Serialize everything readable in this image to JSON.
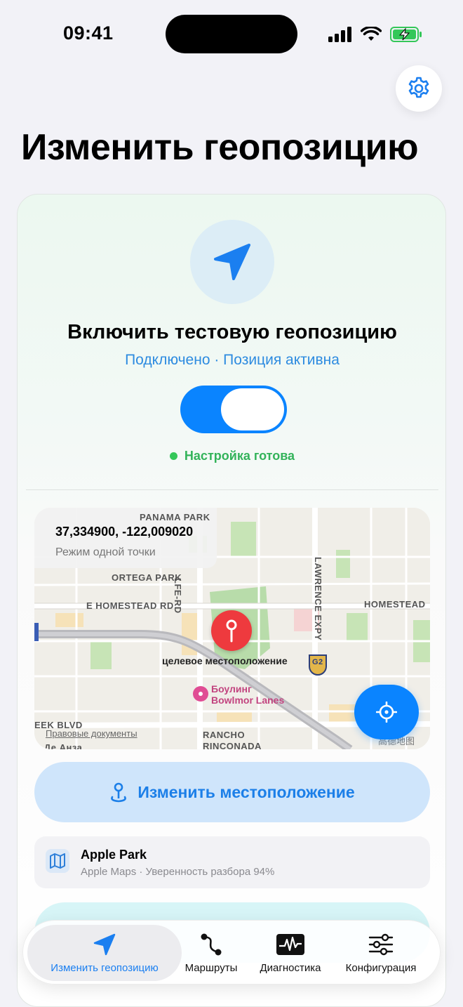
{
  "status_bar": {
    "time": "09:41"
  },
  "page_title": "Изменить геопозицию",
  "hero": {
    "title": "Включить тестовую геопозицию",
    "subtitle": "Подключено · Позиция активна",
    "toggle_on": true,
    "ready_text": "Настройка готова"
  },
  "map": {
    "coordinates": "37,334900, -122,009020",
    "mode": "Режим одной точки",
    "labels": {
      "panama_park": "PANAMA PARK",
      "ortega_park": "ORTEGA PARK",
      "homestead_w": "E HOMESTEAD RD",
      "homestead_e": "HOMESTEAD",
      "lfe_rd": "LFE-RD",
      "lawrence": "LAWRENCE EXPY",
      "eek_blvd": "EEK BLVD",
      "rancho": "RANCHO",
      "rinconada": "RINCONADA",
      "de_anza": "ж Де Анза",
      "highway": "G2"
    },
    "pin_label": "целевое местоположение",
    "poi_label_1": "Боулинг",
    "poi_label_2": "Bowlmor Lanes",
    "legal": "Правовые документы",
    "watermark": "高德地图"
  },
  "change_location_button": "Изменить местоположение",
  "place": {
    "name": "Apple Park",
    "meta": "Apple Maps · Уверенность разбора 94%"
  },
  "tabs": [
    {
      "label": "Изменить геопозицию",
      "active": true
    },
    {
      "label": "Маршруты",
      "active": false
    },
    {
      "label": "Диагностика",
      "active": false
    },
    {
      "label": "Конфигурация",
      "active": false
    }
  ],
  "colors": {
    "accent": "#0a84ff",
    "success": "#34c759",
    "pin": "#ee3a3e"
  }
}
